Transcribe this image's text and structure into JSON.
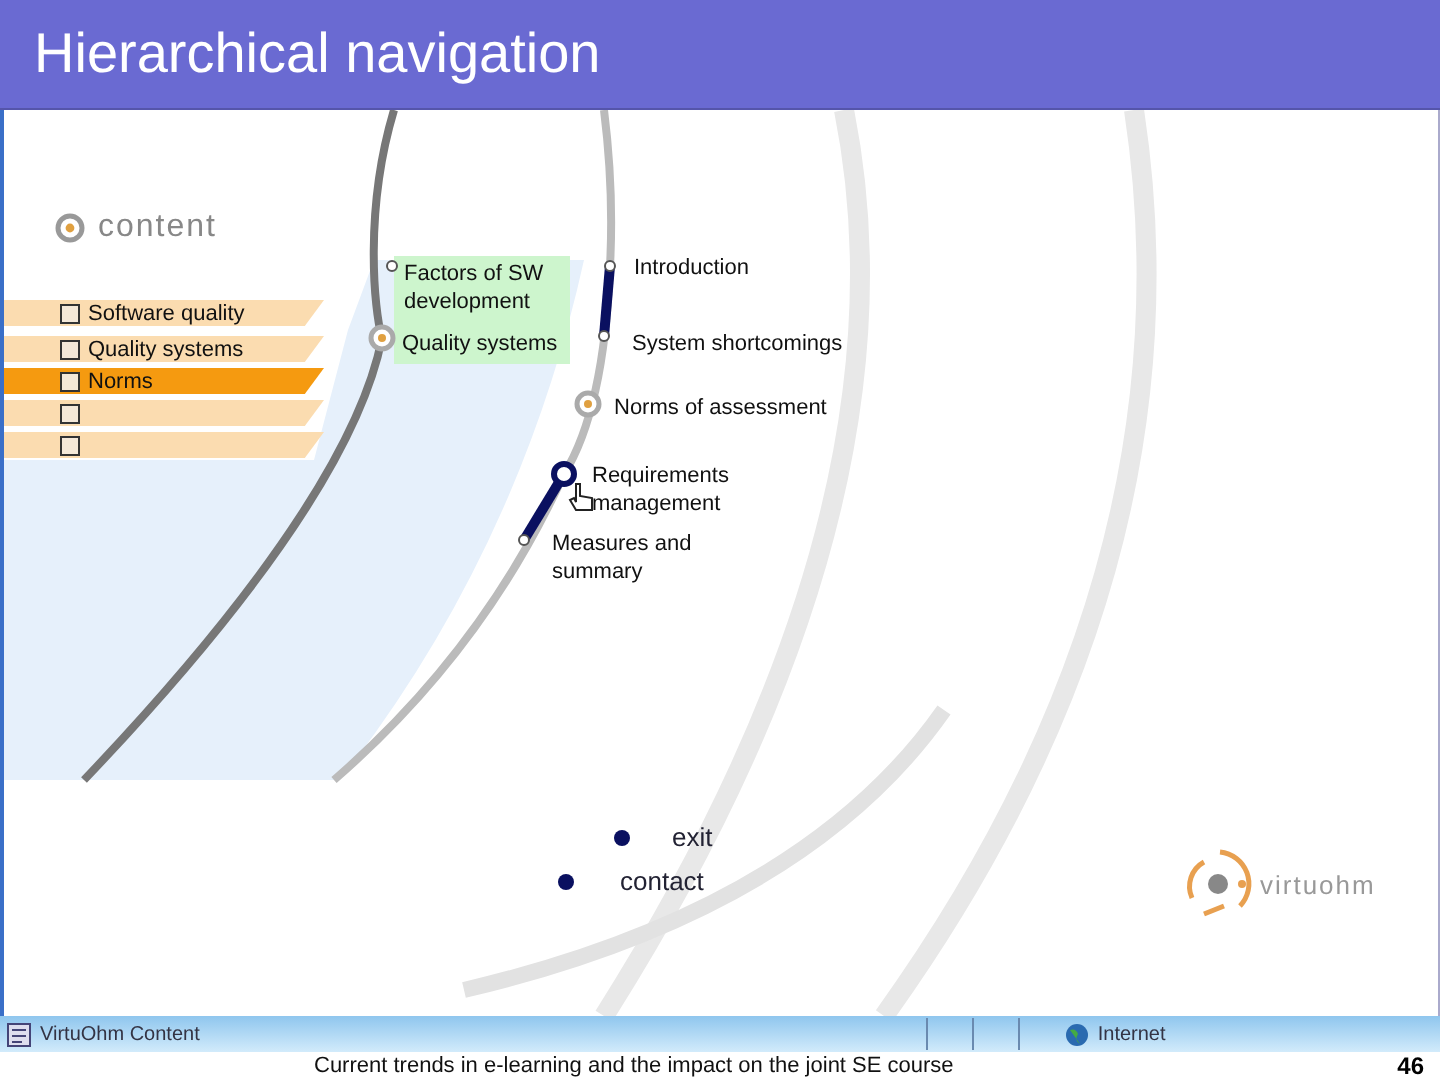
{
  "slide_title": "Hierarchical navigation",
  "content_heading": "content",
  "menu": [
    {
      "label": "Software quality",
      "selected": false
    },
    {
      "label": "Quality systems",
      "selected": false
    },
    {
      "label": "Norms",
      "selected": true
    },
    {
      "selected": false
    },
    {
      "selected": false
    }
  ],
  "nodes": [
    {
      "label": "Factors of SW development",
      "kind": "dot"
    },
    {
      "label": "Quality systems",
      "kind": "ring"
    },
    {
      "label": "Introduction",
      "kind": "dot"
    },
    {
      "label": "System shortcomings",
      "kind": "dot"
    },
    {
      "label": "Norms of assessment",
      "kind": "ring"
    },
    {
      "label": "Requirements management",
      "kind": "current"
    },
    {
      "label": "Measures and summary",
      "kind": "dot"
    }
  ],
  "links": [
    {
      "label": "exit"
    },
    {
      "label": "contact"
    }
  ],
  "logo": "virtuohm",
  "status_bar": {
    "page_title": "VirtuOhm Content",
    "zone": "Internet"
  },
  "footer": {
    "text": "Current trends in e-learning and the impact on the joint SE course",
    "page_number": "46"
  }
}
